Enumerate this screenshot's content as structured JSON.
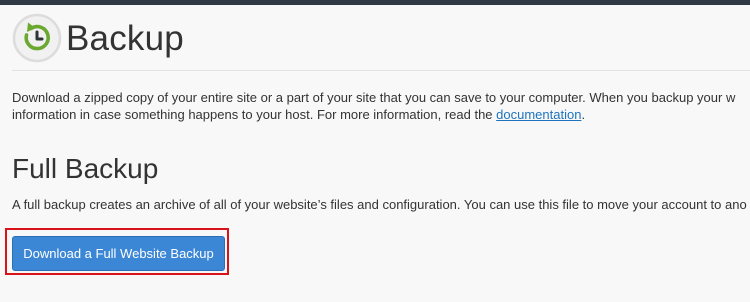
{
  "header": {
    "title": "Backup",
    "icon": "backup-clock-icon",
    "icon_colors": {
      "ring": "#e2e2e2",
      "arrow": "#6aa830",
      "clock": "#2d3538"
    }
  },
  "intro": {
    "text_before_link": "Download a zipped copy of your entire site or a part of your site that you can save to your computer. When you backup your website, you have an extra copy of your information in case something happens to your host. For more information, read the ",
    "line1": "Download a zipped copy of your entire site or a part of your site that you can save to your computer. When you backup your w",
    "line2": "information in case something happens to your host. For more information, read the ",
    "link_text": "documentation",
    "after_link": "."
  },
  "full_backup": {
    "title": "Full Backup",
    "description": "A full backup creates an archive of all of your website’s files and configuration. You can use this file to move your account to ano",
    "button_label": "Download a Full Website Backup",
    "highlight_color": "#d9131a",
    "button_color": "#3b87d6"
  }
}
